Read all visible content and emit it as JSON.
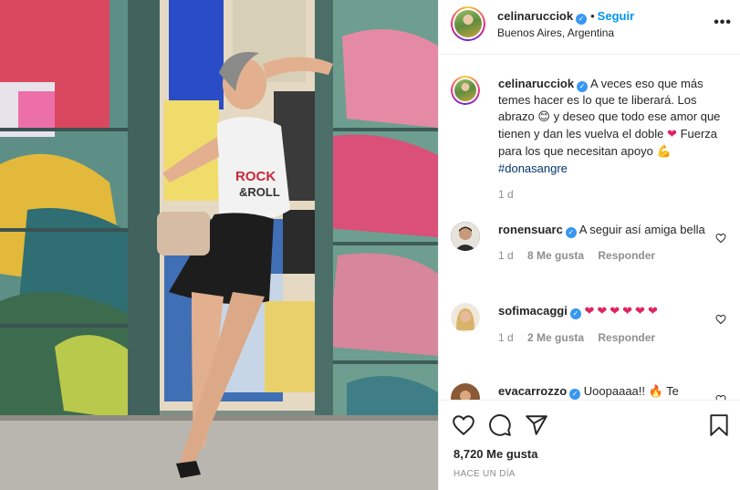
{
  "post": {
    "author": "celinarucciok",
    "follow_label": "Seguir",
    "location": "Buenos Aires, Argentina",
    "dot": "•",
    "more": "•••",
    "caption_user": "celinarucciok",
    "caption_part1": "A veces eso que más temes hacer es lo que te liberará. Los abrazo",
    "caption_emoji1": "😊",
    "caption_part2": "y deseo que todo ese amor que tienen y dan les vuelva el doble",
    "caption_emoji2": "❤",
    "caption_part3": "Fuerza para los que necesitan apoyo",
    "caption_emoji3": "💪",
    "hashtag": "#donasangre",
    "caption_time": "1 d",
    "likes": "8,720 Me gusta",
    "time_ago": "HACE UN DÍA"
  },
  "comments": [
    {
      "user": "ronensuarc",
      "text": "A seguir así amiga bella",
      "time": "1 d",
      "likes": "8 Me gusta",
      "reply": "Responder"
    },
    {
      "user": "sofimacaggi",
      "text": "❤❤❤❤❤❤",
      "time": "1 d",
      "likes": "2 Me gusta",
      "reply": "Responder"
    },
    {
      "user": "evacarrozzo",
      "text": "Uoopaaaa!! 🔥 Te"
    }
  ],
  "icons": [
    "verified-icon",
    "more-icon",
    "heart-icon",
    "comment-icon",
    "share-icon",
    "bookmark-icon"
  ],
  "colors": {
    "accent": "#0095f6",
    "verified": "#3897f0",
    "heart": "#e0245e",
    "muted": "#8e8e8e"
  }
}
